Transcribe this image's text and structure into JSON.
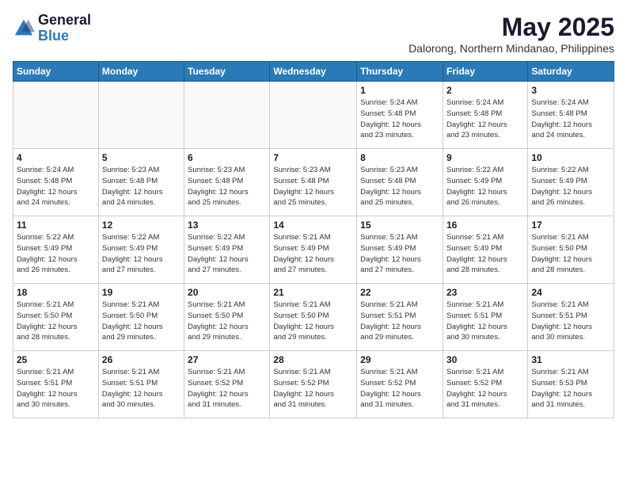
{
  "logo": {
    "general": "General",
    "blue": "Blue"
  },
  "title": {
    "month_year": "May 2025",
    "location": "Dalorong, Northern Mindanao, Philippines"
  },
  "days_of_week": [
    "Sunday",
    "Monday",
    "Tuesday",
    "Wednesday",
    "Thursday",
    "Friday",
    "Saturday"
  ],
  "weeks": [
    {
      "days": [
        {
          "num": "",
          "info": ""
        },
        {
          "num": "",
          "info": ""
        },
        {
          "num": "",
          "info": ""
        },
        {
          "num": "",
          "info": ""
        },
        {
          "num": "1",
          "info": "Sunrise: 5:24 AM\nSunset: 5:48 PM\nDaylight: 12 hours\nand 23 minutes."
        },
        {
          "num": "2",
          "info": "Sunrise: 5:24 AM\nSunset: 5:48 PM\nDaylight: 12 hours\nand 23 minutes."
        },
        {
          "num": "3",
          "info": "Sunrise: 5:24 AM\nSunset: 5:48 PM\nDaylight: 12 hours\nand 24 minutes."
        }
      ]
    },
    {
      "days": [
        {
          "num": "4",
          "info": "Sunrise: 5:24 AM\nSunset: 5:48 PM\nDaylight: 12 hours\nand 24 minutes."
        },
        {
          "num": "5",
          "info": "Sunrise: 5:23 AM\nSunset: 5:48 PM\nDaylight: 12 hours\nand 24 minutes."
        },
        {
          "num": "6",
          "info": "Sunrise: 5:23 AM\nSunset: 5:48 PM\nDaylight: 12 hours\nand 25 minutes."
        },
        {
          "num": "7",
          "info": "Sunrise: 5:23 AM\nSunset: 5:48 PM\nDaylight: 12 hours\nand 25 minutes."
        },
        {
          "num": "8",
          "info": "Sunrise: 5:23 AM\nSunset: 5:48 PM\nDaylight: 12 hours\nand 25 minutes."
        },
        {
          "num": "9",
          "info": "Sunrise: 5:22 AM\nSunset: 5:49 PM\nDaylight: 12 hours\nand 26 minutes."
        },
        {
          "num": "10",
          "info": "Sunrise: 5:22 AM\nSunset: 5:49 PM\nDaylight: 12 hours\nand 26 minutes."
        }
      ]
    },
    {
      "days": [
        {
          "num": "11",
          "info": "Sunrise: 5:22 AM\nSunset: 5:49 PM\nDaylight: 12 hours\nand 26 minutes."
        },
        {
          "num": "12",
          "info": "Sunrise: 5:22 AM\nSunset: 5:49 PM\nDaylight: 12 hours\nand 27 minutes."
        },
        {
          "num": "13",
          "info": "Sunrise: 5:22 AM\nSunset: 5:49 PM\nDaylight: 12 hours\nand 27 minutes."
        },
        {
          "num": "14",
          "info": "Sunrise: 5:21 AM\nSunset: 5:49 PM\nDaylight: 12 hours\nand 27 minutes."
        },
        {
          "num": "15",
          "info": "Sunrise: 5:21 AM\nSunset: 5:49 PM\nDaylight: 12 hours\nand 27 minutes."
        },
        {
          "num": "16",
          "info": "Sunrise: 5:21 AM\nSunset: 5:49 PM\nDaylight: 12 hours\nand 28 minutes."
        },
        {
          "num": "17",
          "info": "Sunrise: 5:21 AM\nSunset: 5:50 PM\nDaylight: 12 hours\nand 28 minutes."
        }
      ]
    },
    {
      "days": [
        {
          "num": "18",
          "info": "Sunrise: 5:21 AM\nSunset: 5:50 PM\nDaylight: 12 hours\nand 28 minutes."
        },
        {
          "num": "19",
          "info": "Sunrise: 5:21 AM\nSunset: 5:50 PM\nDaylight: 12 hours\nand 29 minutes."
        },
        {
          "num": "20",
          "info": "Sunrise: 5:21 AM\nSunset: 5:50 PM\nDaylight: 12 hours\nand 29 minutes."
        },
        {
          "num": "21",
          "info": "Sunrise: 5:21 AM\nSunset: 5:50 PM\nDaylight: 12 hours\nand 29 minutes."
        },
        {
          "num": "22",
          "info": "Sunrise: 5:21 AM\nSunset: 5:51 PM\nDaylight: 12 hours\nand 29 minutes."
        },
        {
          "num": "23",
          "info": "Sunrise: 5:21 AM\nSunset: 5:51 PM\nDaylight: 12 hours\nand 30 minutes."
        },
        {
          "num": "24",
          "info": "Sunrise: 5:21 AM\nSunset: 5:51 PM\nDaylight: 12 hours\nand 30 minutes."
        }
      ]
    },
    {
      "days": [
        {
          "num": "25",
          "info": "Sunrise: 5:21 AM\nSunset: 5:51 PM\nDaylight: 12 hours\nand 30 minutes."
        },
        {
          "num": "26",
          "info": "Sunrise: 5:21 AM\nSunset: 5:51 PM\nDaylight: 12 hours\nand 30 minutes."
        },
        {
          "num": "27",
          "info": "Sunrise: 5:21 AM\nSunset: 5:52 PM\nDaylight: 12 hours\nand 31 minutes."
        },
        {
          "num": "28",
          "info": "Sunrise: 5:21 AM\nSunset: 5:52 PM\nDaylight: 12 hours\nand 31 minutes."
        },
        {
          "num": "29",
          "info": "Sunrise: 5:21 AM\nSunset: 5:52 PM\nDaylight: 12 hours\nand 31 minutes."
        },
        {
          "num": "30",
          "info": "Sunrise: 5:21 AM\nSunset: 5:52 PM\nDaylight: 12 hours\nand 31 minutes."
        },
        {
          "num": "31",
          "info": "Sunrise: 5:21 AM\nSunset: 5:53 PM\nDaylight: 12 hours\nand 31 minutes."
        }
      ]
    }
  ]
}
